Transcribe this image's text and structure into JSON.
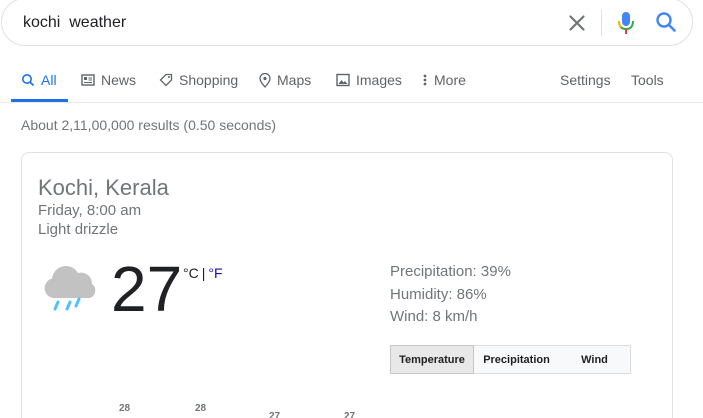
{
  "search": {
    "query": "kochi  weather"
  },
  "tabs": [
    {
      "label": "All",
      "active": true,
      "icon": "search-icon"
    },
    {
      "label": "News",
      "active": false,
      "icon": "news-icon"
    },
    {
      "label": "Shopping",
      "active": false,
      "icon": "tag-icon"
    },
    {
      "label": "Maps",
      "active": false,
      "icon": "map-pin-icon"
    },
    {
      "label": "Images",
      "active": false,
      "icon": "image-icon"
    },
    {
      "label": "More",
      "active": false,
      "icon": "more-vert-icon"
    }
  ],
  "tools": {
    "settings": "Settings",
    "tools": "Tools"
  },
  "result_stats": "About 2,11,00,000 results (0.50 seconds)",
  "weather": {
    "location": "Kochi, Kerala",
    "time": "Friday, 8:00 am",
    "condition": "Light drizzle",
    "temperature": "27",
    "unit_c": "°C",
    "unit_sep": "|",
    "unit_f": "°F",
    "precipitation": "Precipitation: 39%",
    "humidity": "Humidity: 86%",
    "wind": "Wind: 8 km/h",
    "views": [
      "Temperature",
      "Precipitation",
      "Wind"
    ],
    "active_view": "Temperature",
    "chart_labels": [
      "28",
      "28",
      "27",
      "27"
    ],
    "icon": "rain-cloud-icon"
  },
  "colors": {
    "accent": "#1a73e8",
    "link": "#1a0dab",
    "muted": "#70757a"
  }
}
